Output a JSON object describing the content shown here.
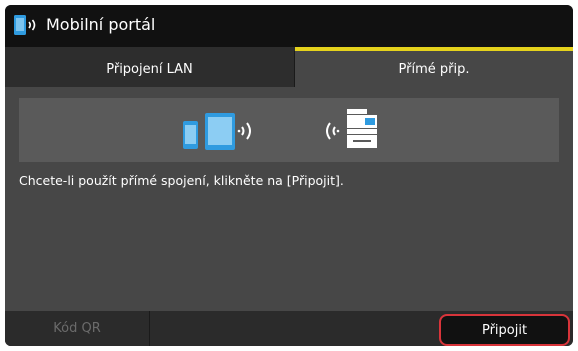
{
  "header": {
    "title": "Mobilní portál",
    "icon": "mobile-wireless-icon"
  },
  "tabs": [
    {
      "label": "Připojení LAN",
      "selected": false
    },
    {
      "label": "Přímé přip.",
      "selected": true
    }
  ],
  "main": {
    "message": "Chcete-li použít přímé spojení, klikněte na [Připojit].",
    "illustration_icons": [
      "phone-icon",
      "tablet-icon",
      "wireless-signal-icon",
      "wireless-signal-icon",
      "printer-icon"
    ]
  },
  "footer": {
    "qr_label": "Kód QR",
    "qr_enabled": false,
    "connect_label": "Připojit"
  },
  "colors": {
    "accent": "#e5d21c",
    "device_blue": "#2f9be0",
    "highlight": "#d8343a"
  }
}
